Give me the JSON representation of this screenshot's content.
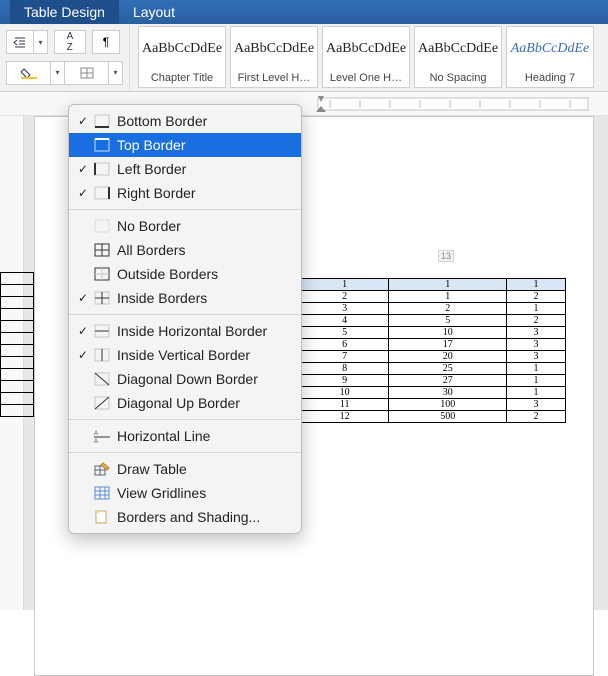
{
  "ribbon": {
    "tabs": {
      "table_design": "Table Design",
      "layout": "Layout"
    }
  },
  "styles": {
    "preview": "AaBbCcDdEe",
    "items": [
      {
        "label": "Chapter Title"
      },
      {
        "label": "First Level H…"
      },
      {
        "label": "Level One H…"
      },
      {
        "label": "No Spacing"
      },
      {
        "label": "Heading 7",
        "italic": true
      }
    ]
  },
  "menu": {
    "bottom_border": "Bottom Border",
    "top_border": "Top Border",
    "left_border": "Left Border",
    "right_border": "Right Border",
    "no_border": "No Border",
    "all_borders": "All Borders",
    "outside_borders": "Outside Borders",
    "inside_borders": "Inside Borders",
    "inside_horizontal": "Inside Horizontal Border",
    "inside_vertical": "Inside Vertical Border",
    "diag_down": "Diagonal Down Border",
    "diag_up": "Diagonal Up Border",
    "horizontal_line": "Horizontal Line",
    "draw_table": "Draw Table",
    "view_gridlines": "View Gridlines",
    "borders_shading": "Borders and Shading..."
  },
  "balloon": "13",
  "chart_data": {
    "type": "table",
    "columns": 3,
    "rows": [
      [
        1,
        1,
        1
      ],
      [
        2,
        1,
        2
      ],
      [
        3,
        2,
        1
      ],
      [
        4,
        5,
        2
      ],
      [
        5,
        10,
        3
      ],
      [
        6,
        17,
        3
      ],
      [
        7,
        20,
        3
      ],
      [
        8,
        25,
        1
      ],
      [
        9,
        27,
        1
      ],
      [
        10,
        30,
        1
      ],
      [
        11,
        100,
        3
      ],
      [
        12,
        500,
        2
      ]
    ]
  }
}
